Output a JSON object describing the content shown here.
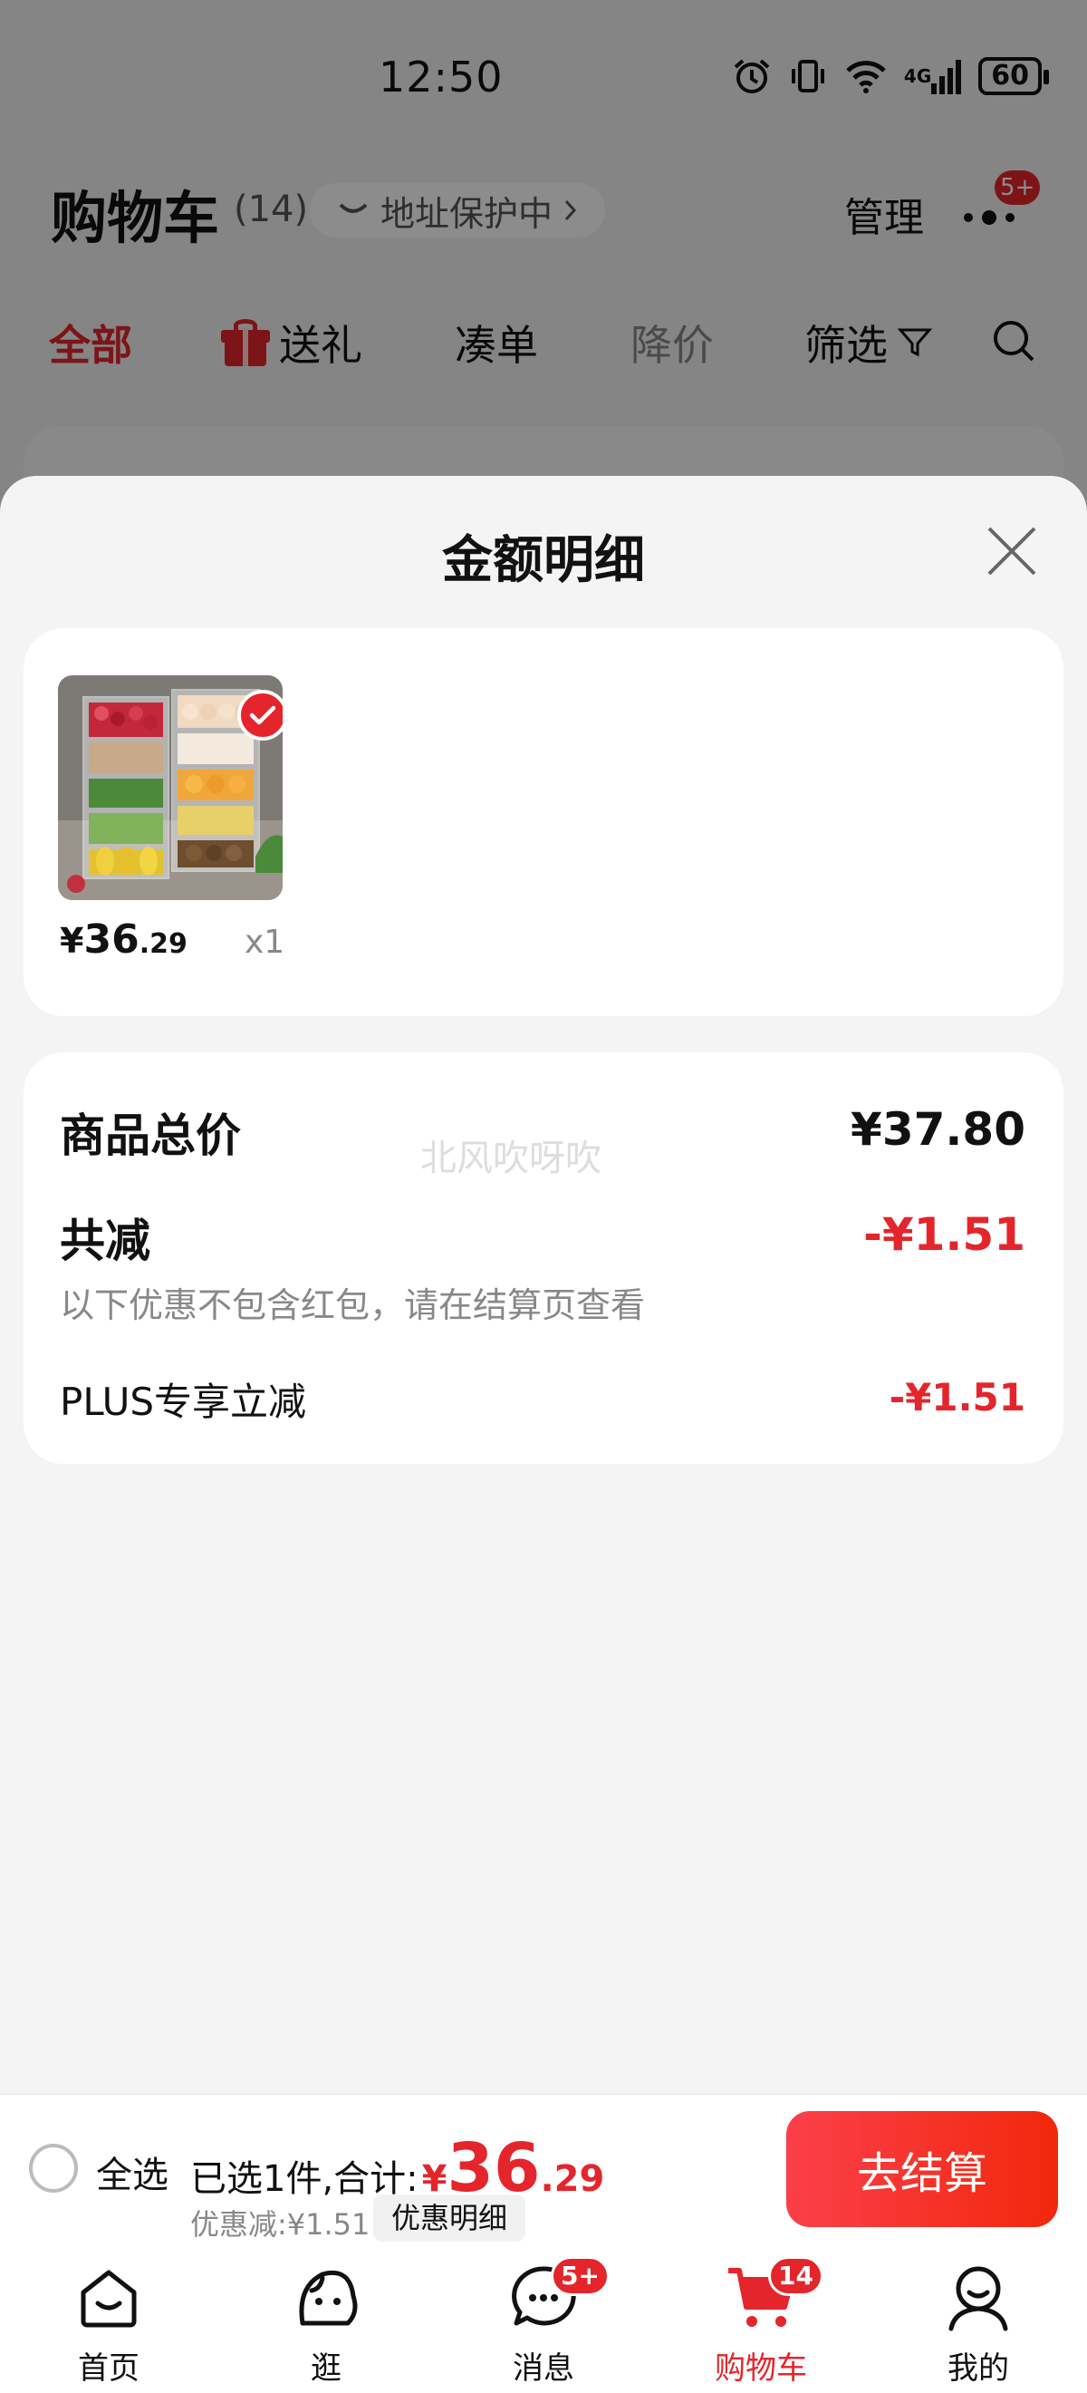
{
  "status_bar": {
    "time": "12:50",
    "network": "4G",
    "battery": "60"
  },
  "header": {
    "title": "购物车",
    "count": "(14)",
    "address_protection": "地址保护中",
    "manage": "管理",
    "more_badge": "5+"
  },
  "filter_tabs": [
    {
      "label": "全部",
      "state": "active"
    },
    {
      "label": "送礼",
      "state": "normal"
    },
    {
      "label": "凑单",
      "state": "normal"
    },
    {
      "label": "降价",
      "state": "muted"
    },
    {
      "label": "筛选",
      "state": "normal"
    }
  ],
  "sheet": {
    "title": "金额明细",
    "item": {
      "price_symbol": "¥",
      "price_int": "36",
      "price_dec": ".29",
      "quantity": "x1"
    },
    "summary": {
      "total_label": "商品总价",
      "total_value": "¥37.80",
      "reduce_label": "共减",
      "reduce_value": "-¥1.51",
      "reduce_note": "以下优惠不包含红包，请在结算页查看",
      "plus_label": "PLUS专享立减",
      "plus_value": "-¥1.51",
      "watermark": "北风吹呀吹"
    }
  },
  "checkout": {
    "select_all": "全选",
    "selected_text": "已选1件,合计:",
    "total_symbol": "¥",
    "total_int": "36",
    "total_dec": ".29",
    "discount_text": "优惠减:¥1.51",
    "detail_button": "优惠明细",
    "checkout_button": "去结算"
  },
  "tab_bar": [
    {
      "label": "首页",
      "icon": "home-icon"
    },
    {
      "label": "逛",
      "icon": "explore-face-icon"
    },
    {
      "label": "消息",
      "icon": "message-bubble-icon",
      "badge": "5+"
    },
    {
      "label": "购物车",
      "icon": "cart-icon",
      "badge": "14",
      "active": true
    },
    {
      "label": "我的",
      "icon": "profile-icon"
    }
  ],
  "colors": {
    "accent": "#e4252b",
    "checkout_gradient_start": "#fb3f4a",
    "checkout_gradient_end": "#f2270c"
  }
}
